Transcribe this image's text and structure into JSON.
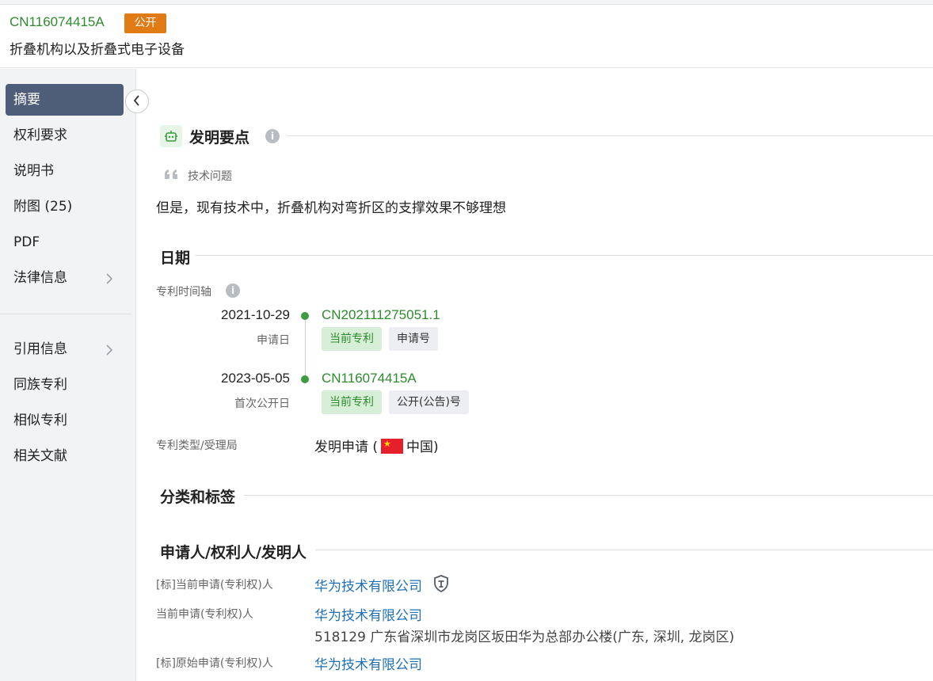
{
  "header": {
    "pub_no": "CN116074415A",
    "status": "公开",
    "title": "折叠机构以及折叠式电子设备"
  },
  "sidebar": {
    "items": [
      {
        "label": "摘要",
        "active": true
      },
      {
        "label": "权利要求"
      },
      {
        "label": "说明书"
      },
      {
        "label": "附图 (25)"
      },
      {
        "label": "PDF"
      },
      {
        "label": "法律信息",
        "chevron": true
      },
      {
        "label": "引用信息",
        "chevron": true
      },
      {
        "label": "同族专利"
      },
      {
        "label": "相似专利"
      },
      {
        "label": "相关文献"
      }
    ]
  },
  "invention_points": {
    "heading": "发明要点",
    "tech_problem_label": "技术问题",
    "tech_problem_text": "但是，现有技术中，折叠机构对弯折区的支撑效果不够理想"
  },
  "dates": {
    "heading": "日期",
    "timeline_label": "专利时间轴",
    "events": [
      {
        "date": "2021-10-29",
        "sub": "申请日",
        "number": "CN202111275051.1",
        "tag1": "当前专利",
        "tag2": "申请号"
      },
      {
        "date": "2023-05-05",
        "sub": "首次公开日",
        "number": "CN116074415A",
        "tag1": "当前专利",
        "tag2": "公开(公告)号"
      }
    ],
    "type_label": "专利类型/受理局",
    "type_value_prefix": "发明申请 (",
    "type_value_country": "中国)"
  },
  "classification": {
    "heading": "分类和标签"
  },
  "parties": {
    "heading": "申请人/权利人/发明人",
    "rows": [
      {
        "label": "[标]当前申请(专利权)人",
        "company": "华为技术有限公司"
      },
      {
        "label": "当前申请(专利权)人",
        "company": "华为技术有限公司",
        "address": "518129 广东省深圳市龙岗区坂田华为总部办公楼(广东, 深圳, 龙岗区)"
      },
      {
        "label": "[标]原始申请(专利权)人",
        "company": "华为技术有限公司"
      }
    ]
  },
  "colors": {
    "accent_green": "#2e8b2e",
    "status_orange": "#e07b16",
    "nav_active": "#4e5d78",
    "link_blue": "#1f6fb5"
  },
  "icons": [
    "robot-icon",
    "info-icon",
    "quote-icon",
    "chevron-left-icon",
    "chevron-right-icon",
    "shield-icon",
    "china-flag-icon"
  ]
}
